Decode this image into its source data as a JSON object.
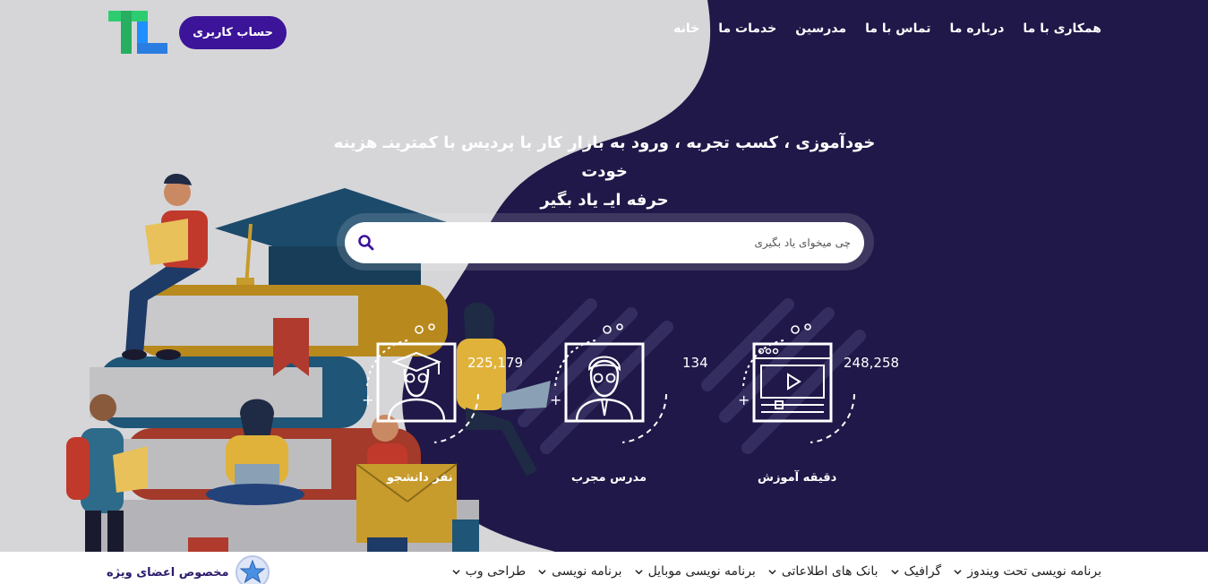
{
  "nav": {
    "items": [
      "خانه",
      "خدمات ما",
      "مدرسین",
      "تماس با ما",
      "درباره ما",
      "همکاری با ما"
    ],
    "account_label": "حساب کاربری"
  },
  "hero": {
    "tagline_line1": "خودآموزی ، کسب تجربه ، ورود به بازار کار با پردیس با کمترینـ هزینه خودت",
    "tagline_line2": "حرفه ایـ یاد بگیر"
  },
  "search": {
    "placeholder": "چی میخوای یاد بگیری"
  },
  "stats": [
    {
      "value": "248,258",
      "label": "دقیقه آموزش",
      "icon": "video-player-icon"
    },
    {
      "value": "134",
      "label": "مدرس مجرب",
      "icon": "teacher-icon"
    },
    {
      "value": "225,179",
      "label": "نفر دانشجو",
      "icon": "graduate-icon"
    }
  ],
  "categories": [
    "طراحی وب",
    "برنامه نویسی",
    "برنامه نویسی موبایل",
    "بانک های اطلاعاتی",
    "گرافیک",
    "برنامه نویسی تحت ویندوز"
  ],
  "vip_label": "مخصوص اعضای ویژه",
  "colors": {
    "hero_bg": "#1f1848",
    "accent": "#3b1499",
    "gray_blob": "#d6d6d9"
  }
}
